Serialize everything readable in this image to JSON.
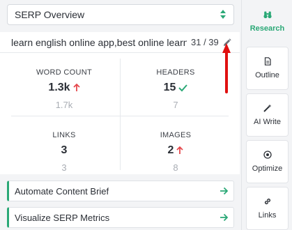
{
  "serp": {
    "selected": "SERP Overview"
  },
  "keyword": {
    "text": "learn english online app,best online learni",
    "count": "31 / 39"
  },
  "stats": {
    "word_count": {
      "label": "WORD COUNT",
      "value": "1.3k",
      "benchmark": "1.7k",
      "indicator": "arrow-up"
    },
    "headers": {
      "label": "HEADERS",
      "value": "15",
      "benchmark": "7",
      "indicator": "check"
    },
    "links": {
      "label": "LINKS",
      "value": "3",
      "benchmark": "3",
      "indicator": "none"
    },
    "images": {
      "label": "IMAGES",
      "value": "2",
      "benchmark": "8",
      "indicator": "arrow-up"
    }
  },
  "actions": [
    {
      "label": "Automate Content Brief",
      "icon": "arrow-right-icon"
    },
    {
      "label": "Visualize SERP Metrics",
      "icon": "arrow-right-icon"
    }
  ],
  "sidebar": {
    "tabs": [
      {
        "label": "Research",
        "icon": "binoculars-icon",
        "active": true
      },
      {
        "label": "Outline",
        "icon": "document-icon",
        "active": false
      },
      {
        "label": "AI Write",
        "icon": "magic-wand-icon",
        "active": false
      },
      {
        "label": "Optimize",
        "icon": "target-icon",
        "active": false
      },
      {
        "label": "Links",
        "icon": "link-icon",
        "active": false
      }
    ]
  },
  "colors": {
    "accent": "#2aa876",
    "alert": "#e5484d",
    "annotation": "#e01010"
  }
}
